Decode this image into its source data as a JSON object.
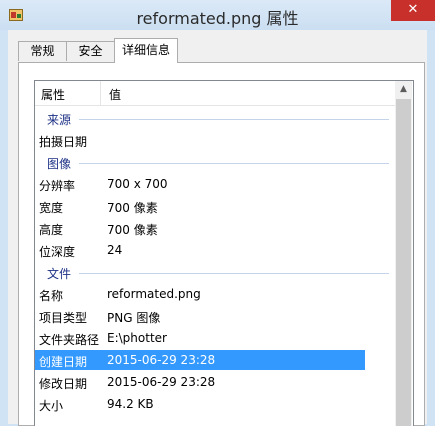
{
  "window": {
    "title": "reformated.png 属性",
    "close_glyph": "✕",
    "icon": "image-file-icon"
  },
  "tabs": [
    {
      "label": "常规",
      "active": false
    },
    {
      "label": "安全",
      "active": false
    },
    {
      "label": "详细信息",
      "active": true
    }
  ],
  "columns": {
    "property": "属性",
    "value": "值"
  },
  "groups": {
    "source": {
      "label": "来源",
      "rows": [
        {
          "name": "拍摄日期",
          "value": ""
        }
      ]
    },
    "image": {
      "label": "图像",
      "rows": [
        {
          "name": "分辨率",
          "value": "700 x 700"
        },
        {
          "name": "宽度",
          "value": "700 像素"
        },
        {
          "name": "高度",
          "value": "700 像素"
        },
        {
          "name": "位深度",
          "value": "24"
        }
      ]
    },
    "file": {
      "label": "文件",
      "rows": [
        {
          "name": "名称",
          "value": "reformated.png"
        },
        {
          "name": "项目类型",
          "value": "PNG 图像"
        },
        {
          "name": "文件夹路径",
          "value": "E:\\photter"
        },
        {
          "name": "创建日期",
          "value": "2015-06-29 23:28",
          "selected": true
        },
        {
          "name": "修改日期",
          "value": "2015-06-29 23:28"
        },
        {
          "name": "大小",
          "value": "94.2 KB"
        }
      ]
    }
  },
  "colors": {
    "selection": "#3399ff",
    "group_header": "#1e3287",
    "close_button": "#c7302b",
    "title_bar": "#cfe3f5"
  }
}
